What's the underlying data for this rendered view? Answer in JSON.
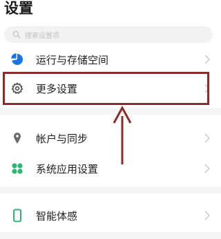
{
  "header": {
    "title": "设置"
  },
  "search": {
    "placeholder": "搜索设置项"
  },
  "settings": {
    "items": [
      {
        "label": "运行与存储空间",
        "icon": "pie-chart-icon",
        "color": "#1a73e8"
      },
      {
        "label": "更多设置",
        "icon": "gear-icon",
        "color": "#4a4a4a"
      },
      {
        "label": "帐户与同步",
        "icon": "location-pin-icon",
        "color": "#6b6b6b"
      },
      {
        "label": "系统应用设置",
        "icon": "apps-grid-icon",
        "color": "#2bb673"
      },
      {
        "label": "智能体感",
        "icon": "phone-icon",
        "color": "#2bb673"
      }
    ]
  },
  "annotation": {
    "color": "#8b2b2b"
  }
}
